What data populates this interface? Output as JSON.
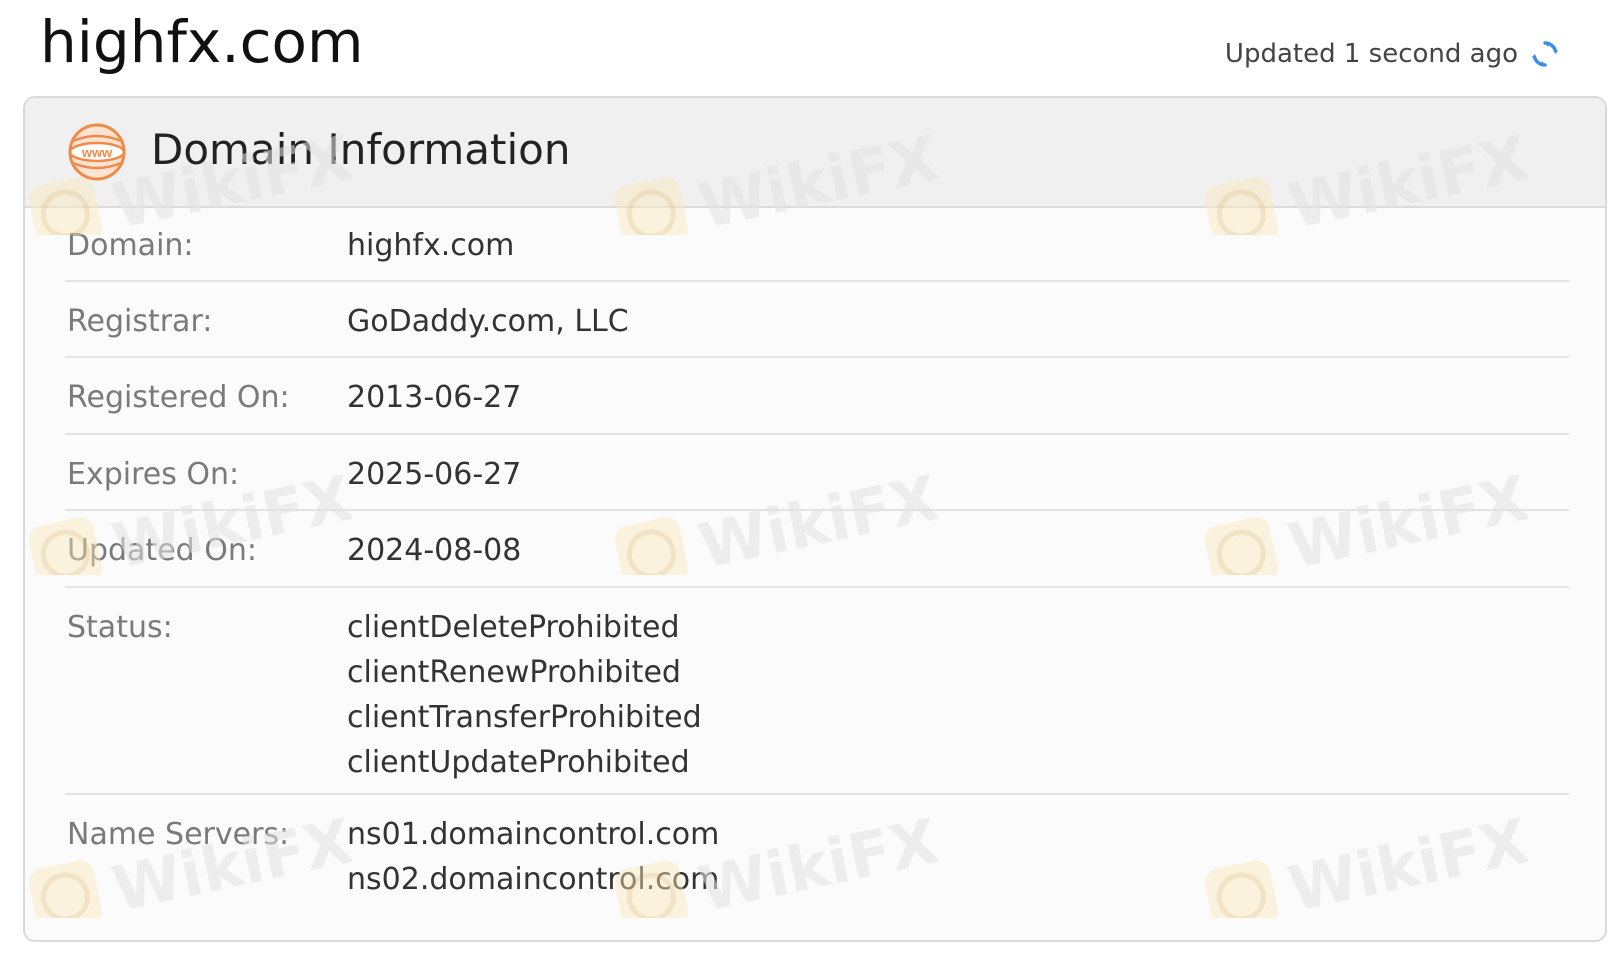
{
  "page": {
    "title": "highfx.com",
    "updated_text": "Updated 1 second ago",
    "refresh_icon": "refresh-icon"
  },
  "card": {
    "icon": "www-icon",
    "icon_text": "www",
    "title": "Domain Information",
    "rows": [
      {
        "label": "Domain:",
        "values": [
          "highfx.com"
        ]
      },
      {
        "label": "Registrar:",
        "values": [
          "GoDaddy.com, LLC"
        ]
      },
      {
        "label": "Registered On:",
        "values": [
          "2013-06-27"
        ]
      },
      {
        "label": "Expires On:",
        "values": [
          "2025-06-27"
        ]
      },
      {
        "label": "Updated On:",
        "values": [
          "2024-08-08"
        ]
      },
      {
        "label": "Status:",
        "values": [
          "clientDeleteProhibited",
          "clientRenewProhibited",
          "clientTransferProhibited",
          "clientUpdateProhibited"
        ]
      },
      {
        "label": "Name Servers:",
        "values": [
          "ns01.domaincontrol.com",
          "ns02.domaincontrol.com"
        ]
      }
    ]
  },
  "watermark": {
    "text": "WikiFX",
    "icon": "wikifx-logo-icon"
  },
  "colors": {
    "accent_orange": "#f08a4b",
    "refresh_blue": "#3a8ee6",
    "header_bg": "#f0f0f0",
    "card_bg": "#fbfbfb",
    "label_gray": "#7a7a7a"
  }
}
